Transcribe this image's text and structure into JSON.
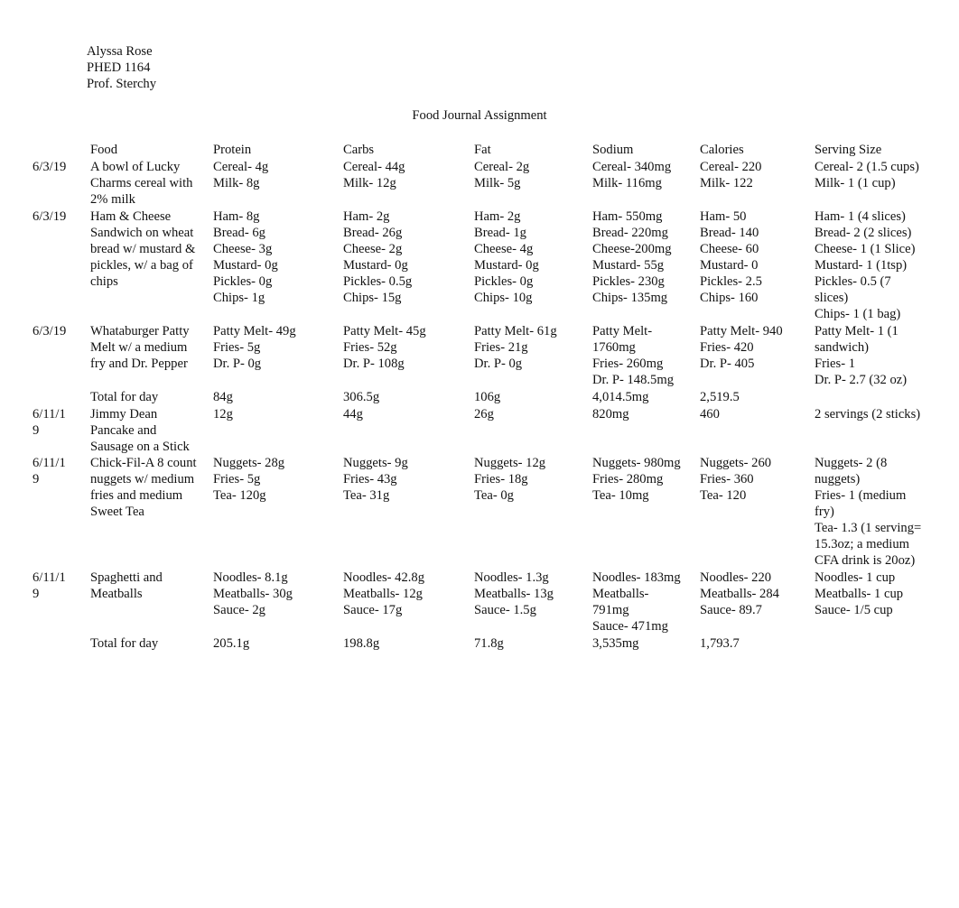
{
  "header": {
    "student_name": "Alyssa Rose",
    "course": "PHED 1164",
    "professor": "Prof. Sterchy"
  },
  "title": "Food Journal Assignment",
  "table": {
    "columns": [
      "",
      "Food",
      "Protein",
      "Carbs",
      "Fat",
      "Sodium",
      "Calories",
      "Serving Size"
    ],
    "rows": [
      {
        "date": [
          "6/3/19"
        ],
        "food": [
          "A bowl of Lucky",
          "Charms cereal with",
          "2% milk"
        ],
        "protein": [
          "Cereal- 4g",
          "Milk- 8g"
        ],
        "carbs": [
          "Cereal- 44g",
          "Milk- 12g"
        ],
        "fat": [
          "Cereal- 2g",
          "Milk- 5g"
        ],
        "sodium": [
          "Cereal- 340mg",
          "Milk- 116mg"
        ],
        "calories": [
          "Cereal- 220",
          "Milk- 122"
        ],
        "serving": [
          "Cereal- 2 (1.5 cups)",
          "Milk- 1 (1 cup)"
        ]
      },
      {
        "date": [
          "6/3/19"
        ],
        "food": [
          "Ham & Cheese",
          "Sandwich on wheat",
          "bread w/ mustard &",
          "pickles, w/ a bag of",
          "chips"
        ],
        "protein": [
          "Ham- 8g",
          "Bread- 6g",
          "Cheese- 3g",
          "Mustard- 0g",
          "Pickles- 0g",
          "Chips- 1g"
        ],
        "carbs": [
          "Ham- 2g",
          "Bread- 26g",
          "Cheese- 2g",
          "Mustard- 0g",
          "Pickles- 0.5g",
          "Chips- 15g"
        ],
        "fat": [
          "Ham- 2g",
          "Bread- 1g",
          "Cheese- 4g",
          "Mustard- 0g",
          "Pickles- 0g",
          "Chips- 10g"
        ],
        "sodium": [
          "Ham- 550mg",
          "Bread- 220mg",
          "Cheese-200mg",
          "Mustard- 55g",
          "Pickles- 230g",
          "Chips- 135mg"
        ],
        "calories": [
          "Ham- 50",
          "Bread- 140",
          "Cheese- 60",
          "Mustard- 0",
          "Pickles- 2.5",
          "Chips- 160"
        ],
        "serving": [
          "Ham- 1 (4 slices)",
          "Bread- 2 (2 slices)",
          "Cheese- 1 (1 Slice)",
          "Mustard- 1 (1tsp)",
          "Pickles- 0.5 (7",
          "slices)",
          "Chips- 1 (1 bag)"
        ]
      },
      {
        "date": [
          "6/3/19"
        ],
        "food": [
          "Whataburger Patty",
          "Melt w/ a medium",
          "fry and Dr. Pepper"
        ],
        "protein": [
          "Patty Melt- 49g",
          "Fries- 5g",
          "Dr. P- 0g"
        ],
        "carbs": [
          "Patty Melt- 45g",
          "Fries- 52g",
          "Dr. P- 108g"
        ],
        "fat": [
          "Patty Melt- 61g",
          "Fries- 21g",
          "Dr. P- 0g"
        ],
        "sodium": [
          "Patty Melt-",
          "1760mg",
          "Fries- 260mg",
          "Dr. P- 148.5mg"
        ],
        "calories": [
          "Patty Melt- 940",
          "Fries- 420",
          "Dr. P- 405"
        ],
        "serving": [
          "Patty Melt- 1 (1",
          "sandwich)",
          "Fries- 1",
          "Dr. P- 2.7 (32 oz)"
        ]
      },
      {
        "date": [],
        "food": [
          "Total for day"
        ],
        "protein": [
          "84g"
        ],
        "carbs": [
          "306.5g"
        ],
        "fat": [
          "106g"
        ],
        "sodium": [
          "4,014.5mg"
        ],
        "calories": [
          "2,519.5"
        ],
        "serving": []
      },
      {
        "date": [
          "6/11/1",
          "9"
        ],
        "food": [
          "Jimmy Dean",
          "Pancake and",
          "Sausage on a Stick"
        ],
        "protein": [
          "12g"
        ],
        "carbs": [
          "44g"
        ],
        "fat": [
          "26g"
        ],
        "sodium": [
          "820mg"
        ],
        "calories": [
          "460"
        ],
        "serving": [
          "2 servings (2 sticks)"
        ]
      },
      {
        "date": [
          "6/11/1",
          "9"
        ],
        "food": [
          "Chick-Fil-A 8 count",
          "nuggets w/ medium",
          "fries and medium",
          "Sweet Tea"
        ],
        "protein": [
          "Nuggets- 28g",
          "Fries- 5g",
          "Tea- 120g"
        ],
        "carbs": [
          "Nuggets- 9g",
          "Fries- 43g",
          "Tea- 31g"
        ],
        "fat": [
          "Nuggets- 12g",
          "Fries- 18g",
          "Tea- 0g"
        ],
        "sodium": [
          "Nuggets- 980mg",
          "Fries- 280mg",
          "Tea- 10mg"
        ],
        "calories": [
          "Nuggets- 260",
          "Fries- 360",
          "Tea- 120"
        ],
        "serving": [
          "Nuggets- 2 (8",
          "nuggets)",
          "Fries- 1 (medium",
          "fry)",
          "Tea- 1.3 (1 serving=",
          "15.3oz; a medium",
          "CFA drink is 20oz)"
        ]
      },
      {
        "date": [
          "6/11/1",
          "9"
        ],
        "food": [
          "Spaghetti and",
          "Meatballs"
        ],
        "protein": [
          "Noodles- 8.1g",
          "Meatballs- 30g",
          "Sauce- 2g"
        ],
        "carbs": [
          "Noodles- 42.8g",
          "Meatballs- 12g",
          "Sauce- 17g"
        ],
        "fat": [
          "Noodles- 1.3g",
          "Meatballs- 13g",
          "Sauce- 1.5g"
        ],
        "sodium": [
          "Noodles- 183mg",
          "Meatballs-",
          "791mg",
          "Sauce- 471mg"
        ],
        "calories": [
          "Noodles- 220",
          "Meatballs- 284",
          "Sauce- 89.7"
        ],
        "serving": [
          "Noodles- 1 cup",
          "Meatballs- 1 cup",
          "Sauce- 1/5 cup"
        ]
      },
      {
        "date": [],
        "food": [
          "Total for day"
        ],
        "protein": [
          "205.1g"
        ],
        "carbs": [
          "198.8g"
        ],
        "fat": [
          "71.8g"
        ],
        "sodium": [
          "3,535mg"
        ],
        "calories": [
          "1,793.7"
        ],
        "serving": []
      }
    ]
  }
}
